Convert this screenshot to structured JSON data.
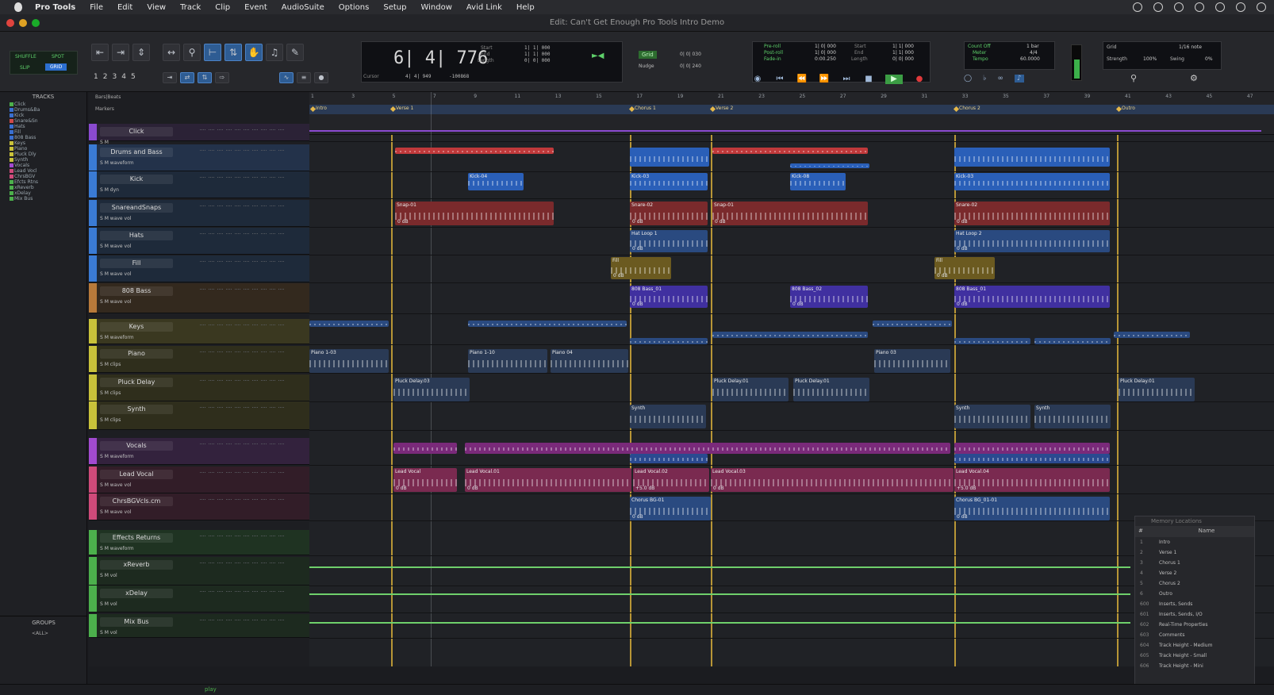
{
  "menubar": {
    "app": "Pro Tools",
    "items": [
      "File",
      "Edit",
      "View",
      "Track",
      "Clip",
      "Event",
      "AudioSuite",
      "Options",
      "Setup",
      "Window",
      "Avid Link",
      "Help"
    ]
  },
  "window": {
    "title": "Edit: Can't Get Enough Pro Tools Intro Demo"
  },
  "toolbar": {
    "modes": {
      "shuffle": "SHUFFLE",
      "spot": "SPOT",
      "slip": "SLIP",
      "grid": "GRID"
    },
    "zoom_presets": [
      "1",
      "2",
      "3",
      "4",
      "5"
    ],
    "main_counter": "6| 4| 776",
    "counter_labels": {
      "start": "Start",
      "end": "End",
      "length": "Length",
      "cursor": "Cursor"
    },
    "counter_values": {
      "start": "1| 1| 000",
      "end": "1| 1| 000",
      "length": "0| 0| 000",
      "cursor": "4| 4| 949",
      "cursor_value": "-100868"
    },
    "grid_label": "Grid",
    "grid_value": "0| 0| 030",
    "nudge_label": "Nudge",
    "nudge_value": "0| 0| 240",
    "transport_labels": {
      "pre_roll": "Pre-roll",
      "post_roll": "Post-roll",
      "fade_in": "Fade-in"
    },
    "transport_values": [
      "1| 0| 000",
      "1| 0| 000",
      "0:00.250"
    ],
    "transport_right_labels": [
      "Start",
      "End",
      "Length"
    ],
    "transport_right_values": [
      "1| 1| 000",
      "1| 1| 000",
      "0| 0| 000"
    ],
    "count_off": "Count Off",
    "meter_label": "Meter",
    "tempo_label": "Tempo",
    "count_off_value": "1 bar",
    "meter_value": "4/4",
    "tempo_value": "60.0000",
    "grid2_label": "Grid",
    "grid2_value": "1/16 note",
    "strength_label": "Strength",
    "strength_value": "100%",
    "swing_label": "Swing",
    "swing_value": "0%"
  },
  "sidebar": {
    "tracks_header": "TRACKS",
    "track_list": [
      "Click",
      "Drums&Ba",
      "Kick",
      "Snare&Sn",
      "Hats",
      "Fill",
      "808 Bass",
      "Keys",
      "Piano",
      "Pluck Dly",
      "Synth",
      "Vocals",
      "Lead Vocl",
      "ChrsBGV",
      "Efcts Rtns",
      "xReverb",
      "xDelay",
      "Mix Bus"
    ],
    "track_colors": [
      "#4cb04c",
      "#3a6fd0",
      "#3a6fd0",
      "#d04a4a",
      "#3a6fd0",
      "#3a6fd0",
      "#3a6fd0",
      "#c9c23a",
      "#c9c23a",
      "#c9c23a",
      "#c9c23a",
      "#a24ad0",
      "#d04a7a",
      "#d04a7a",
      "#4cb04c",
      "#4cb04c",
      "#4cb04c",
      "#4cb04c"
    ],
    "groups_header": "GROUPS",
    "groups_item": "<ALL>"
  },
  "tracks": [
    {
      "name": "Click",
      "sub": "S M",
      "color": "#8a4ad0",
      "bg": "#2b2236"
    },
    {
      "name": "Drums and Bass",
      "sub": "S M  waveform",
      "color": "#3a7bd5",
      "bg": "#23324a"
    },
    {
      "name": "Kick",
      "sub": "S M  dyn",
      "color": "#3a7bd5",
      "bg": "#1e2a3a"
    },
    {
      "name": "SnareandSnaps",
      "sub": "S M  wave  vol",
      "color": "#3a7bd5",
      "bg": "#1e2a3a"
    },
    {
      "name": "Hats",
      "sub": "S M  wave  vol",
      "color": "#3a7bd5",
      "bg": "#1e2a3a"
    },
    {
      "name": "Fill",
      "sub": "S M  wave  vol",
      "color": "#3a7bd5",
      "bg": "#1e2a3a"
    },
    {
      "name": "808 Bass",
      "sub": "S M  wave  vol",
      "color": "#b87a3a",
      "bg": "#33291e"
    },
    {
      "name": "Keys",
      "sub": "S M  waveform",
      "color": "#c9c23a",
      "bg": "#3a3820"
    },
    {
      "name": "Piano",
      "sub": "S M  clips",
      "color": "#c9c23a",
      "bg": "#2f2e1c"
    },
    {
      "name": "Pluck Delay",
      "sub": "S M  clips",
      "color": "#c9c23a",
      "bg": "#2f2e1c"
    },
    {
      "name": "Synth",
      "sub": "S M  clips",
      "color": "#c9c23a",
      "bg": "#2f2e1c"
    },
    {
      "name": "Vocals",
      "sub": "S M  waveform",
      "color": "#a24ad0",
      "bg": "#33223d"
    },
    {
      "name": "Lead Vocal",
      "sub": "S M  wave  vol",
      "color": "#d04a7a",
      "bg": "#321d28"
    },
    {
      "name": "ChrsBGVcls.cm",
      "sub": "S M  wave  vol",
      "color": "#d04a7a",
      "bg": "#321d28"
    },
    {
      "name": "Effects Returns",
      "sub": "S M  waveform",
      "color": "#4cb04c",
      "bg": "#1f3322"
    },
    {
      "name": "xReverb",
      "sub": "S M  vol",
      "color": "#4cb04c",
      "bg": "#1d2a1f"
    },
    {
      "name": "xDelay",
      "sub": "S M  vol",
      "color": "#4cb04c",
      "bg": "#1d2a1f"
    },
    {
      "name": "Mix Bus",
      "sub": "S M  vol",
      "color": "#4cb04c",
      "bg": "#1d2a1f"
    }
  ],
  "ruler": {
    "bar_numbers": [
      "1",
      "3",
      "5",
      "7",
      "9",
      "11",
      "13",
      "15",
      "17",
      "19",
      "21",
      "23",
      "25",
      "27",
      "29",
      "31",
      "33",
      "35",
      "37",
      "39",
      "41",
      "43",
      "45",
      "47"
    ],
    "markers_label": "Markers",
    "markers": [
      "Intro",
      "Verse 1",
      "Chorus 1",
      "Verse 2",
      "Chorus 2",
      "Outro"
    ]
  },
  "regions": {
    "kick": [
      "Kick-04",
      "Kick-03",
      "Kick-08",
      "Kick-03"
    ],
    "snare": [
      "Snap-01",
      "Snare-02",
      "Snap-01",
      "Snare-02"
    ],
    "hats": [
      "Hat Loop 1",
      "Hat Loop 2"
    ],
    "fill": [
      "Fill",
      "Fill"
    ],
    "bass": [
      "808 Bass_01",
      "808 Bass_02",
      "808 Bass_01"
    ],
    "piano": [
      "Piano 1-03",
      "Piano 1-10",
      "Piano 04",
      "Piano 03"
    ],
    "pluck": [
      "Pluck Delay.03",
      "Pluck Delay.01",
      "Pluck Delay.01",
      "Pluck Delay.01"
    ],
    "synth": [
      "Synth",
      "Synth",
      "Synth"
    ],
    "lead_vocal": [
      "Lead Vocal",
      "Lead Vocal.01",
      "Lead Vocal.02",
      "Lead Vocal.03",
      "Lead Vocal.04"
    ],
    "chorus_bgv": [
      "Chorus BG-01",
      "Chorus BG_01-01"
    ],
    "vol_0db": "0 dB",
    "vol_m5": "+5.0 dB"
  },
  "memory_locations": {
    "title": "Memory Locations",
    "col_num": "#",
    "col_name": "Name",
    "items": [
      {
        "num": "1",
        "name": "Intro"
      },
      {
        "num": "2",
        "name": "Verse 1"
      },
      {
        "num": "3",
        "name": "Chorus 1"
      },
      {
        "num": "4",
        "name": "Verse 2"
      },
      {
        "num": "5",
        "name": "Chorus 2"
      },
      {
        "num": "6",
        "name": "Outro"
      },
      {
        "num": "600",
        "name": "Inserts, Sends"
      },
      {
        "num": "601",
        "name": "Inserts, Sends, I/O"
      },
      {
        "num": "602",
        "name": "Real-Time Properties"
      },
      {
        "num": "603",
        "name": "Comments"
      },
      {
        "num": "604",
        "name": "Track Height - Medium"
      },
      {
        "num": "605",
        "name": "Track Height - Small"
      },
      {
        "num": "606",
        "name": "Track Height - Mini"
      }
    ]
  },
  "bottom": {
    "play": "play"
  }
}
